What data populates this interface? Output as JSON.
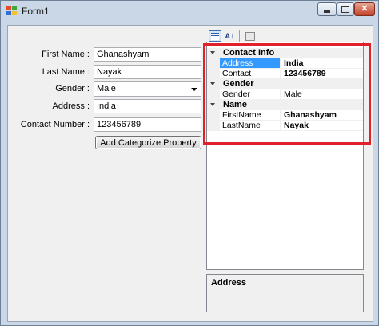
{
  "window": {
    "title": "Form1",
    "icons": {
      "app": "form-app-icon",
      "minimize": "minimize-icon",
      "maximize": "maximize-icon",
      "close": "close-icon"
    }
  },
  "form": {
    "fields": [
      {
        "label": "First Name :",
        "value": "Ghanashyam"
      },
      {
        "label": "Last Name :",
        "value": "Nayak"
      },
      {
        "label": "Gender :",
        "value": "Male"
      },
      {
        "label": "Address :",
        "value": "India"
      },
      {
        "label": "Contact Number :",
        "value": "123456789"
      }
    ],
    "button_label": "Add Categorize Property"
  },
  "property_grid": {
    "toolbar": [
      "categorized-icon",
      "alphabetical-icon",
      "property-pages-icon"
    ],
    "categories": [
      {
        "name": "Contact  Info",
        "props": [
          {
            "name": "Address",
            "value": "India",
            "selected": true,
            "bold": true
          },
          {
            "name": "Contact",
            "value": "123456789",
            "selected": false,
            "bold": true
          }
        ]
      },
      {
        "name": "Gender",
        "props": [
          {
            "name": "Gender",
            "value": "Male",
            "selected": false,
            "bold": false
          }
        ]
      },
      {
        "name": "Name",
        "props": [
          {
            "name": "FirstName",
            "value": "Ghanashyam",
            "selected": false,
            "bold": true
          },
          {
            "name": "LastName",
            "value": "Nayak",
            "selected": false,
            "bold": true
          }
        ]
      }
    ],
    "help_title": "Address"
  },
  "colors": {
    "highlight_box": "#e0202a",
    "selection": "#3399ff"
  }
}
